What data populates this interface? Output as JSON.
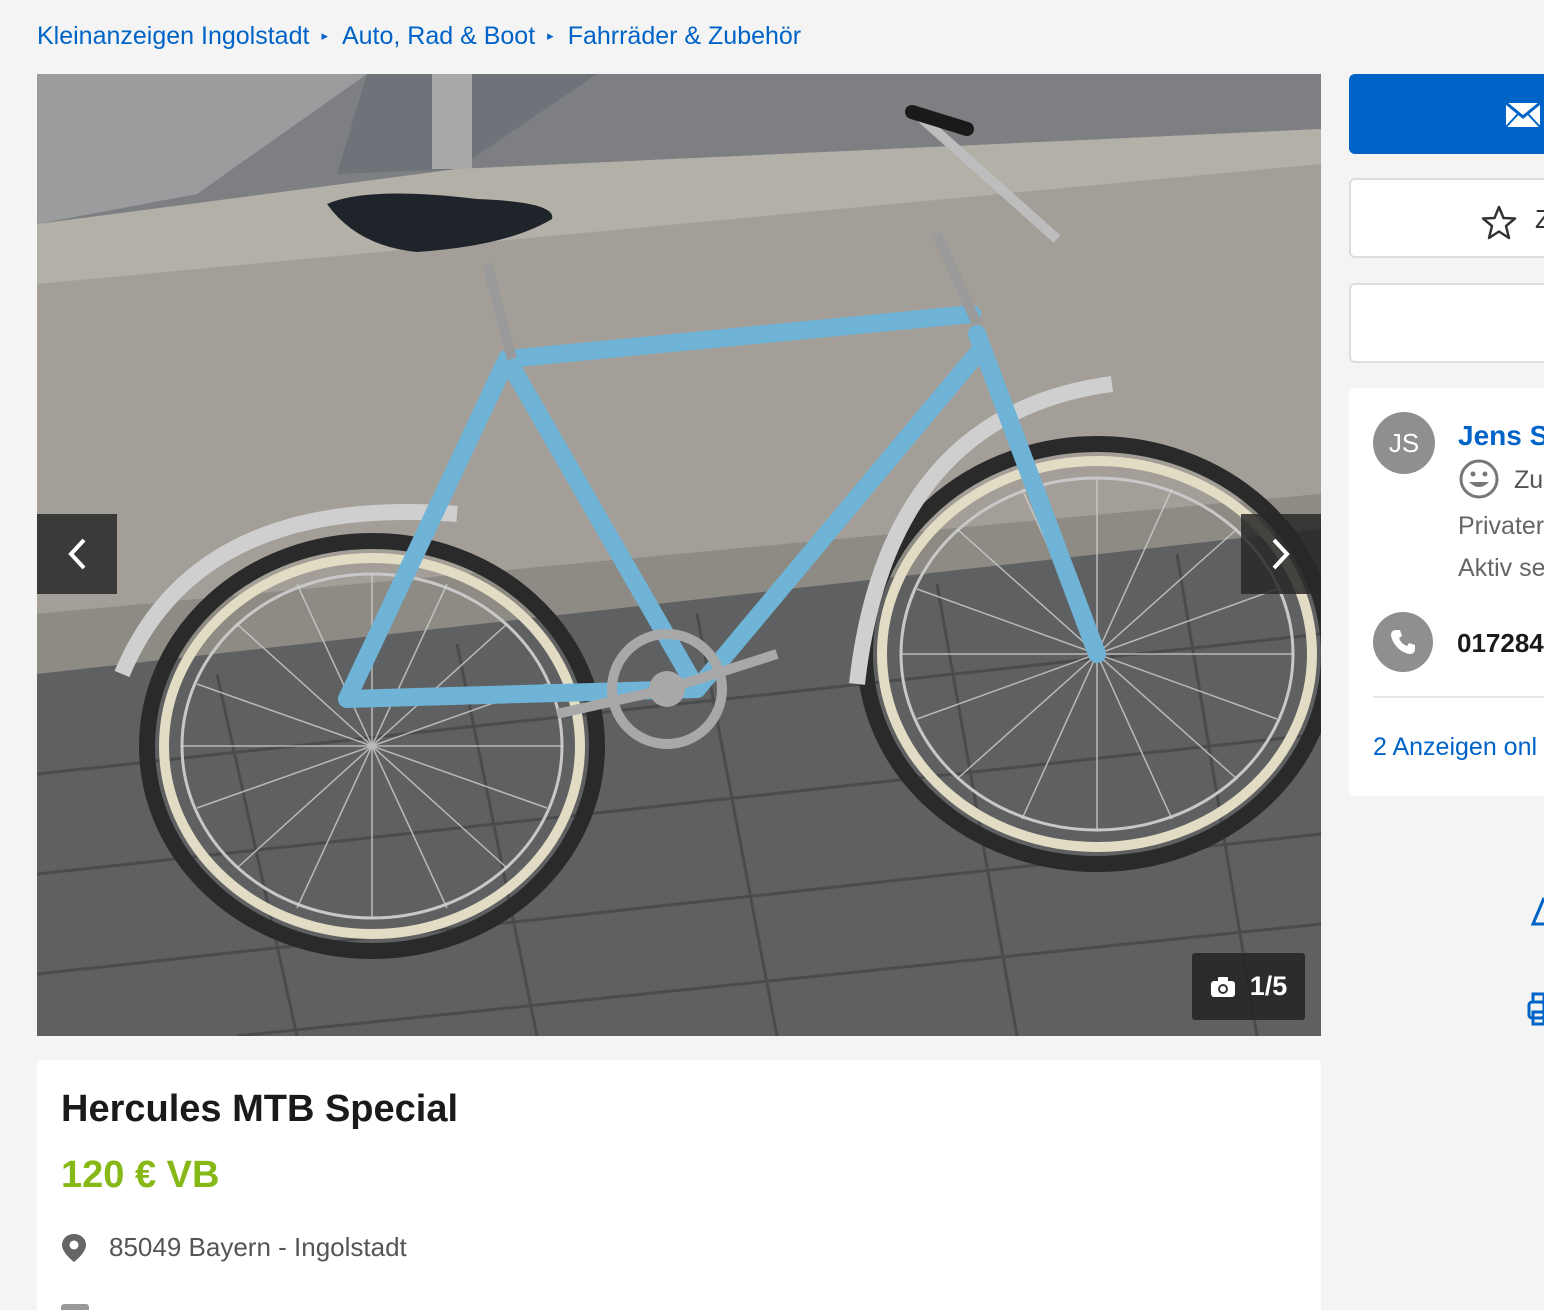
{
  "breadcrumb": {
    "items": [
      {
        "label": "Kleinanzeigen Ingolstadt"
      },
      {
        "label": "Auto, Rad & Boot"
      },
      {
        "label": "Fahrräder & Zubehör"
      }
    ],
    "separator": "▸"
  },
  "gallery": {
    "counter": "1/5",
    "prev_icon": "chevron-left-icon",
    "next_icon": "chevron-right-icon",
    "camera_icon": "camera-icon"
  },
  "ad": {
    "title": "Hercules MTB Special",
    "price": "120 € VB",
    "location": "85049 Bayern - Ingolstadt"
  },
  "sidebar": {
    "contact_icon": "mail-icon",
    "watch_label": "Z",
    "seller": {
      "initials": "JS",
      "name": "Jens S",
      "rating": "Zu",
      "type": "Privater",
      "active_since": "Aktiv se",
      "phone": "017284",
      "ads_link": "2 Anzeigen onl"
    }
  },
  "colors": {
    "link": "#0063c8",
    "price": "#86b817",
    "background": "#f4f4f4",
    "button_primary": "#0063c8"
  }
}
